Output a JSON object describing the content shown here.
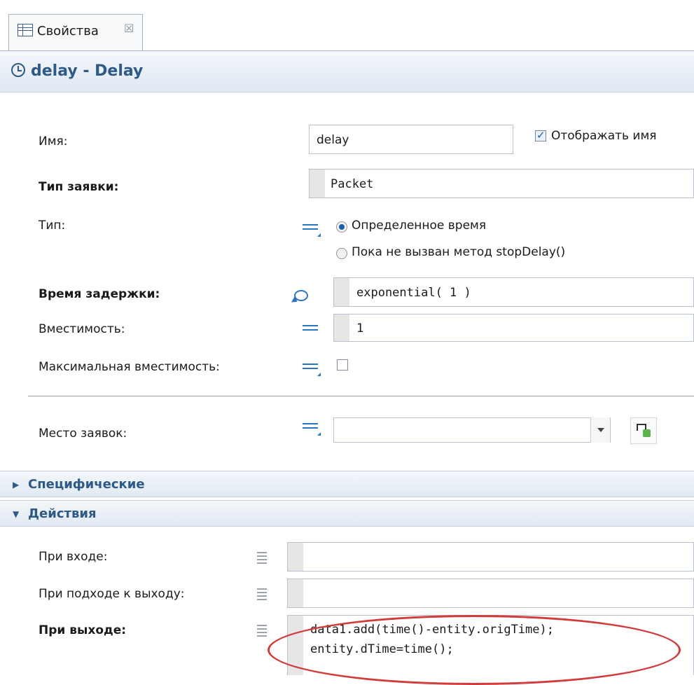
{
  "tab": {
    "label": "Свойства",
    "close": "☒"
  },
  "title": "delay - Delay",
  "props": {
    "name_label": "Имя:",
    "name_value": "delay",
    "show_name_label": "Отображать имя",
    "agent_type_label": "Тип заявки:",
    "agent_type_value": "Packet",
    "type_label": "Тип:",
    "type_option1": "Определенное время",
    "type_option2": "Пока не вызван метод stopDelay()",
    "delay_time_label": "Время задержки:",
    "delay_time_value": "exponential( 1 )",
    "capacity_label": "Вместимость:",
    "capacity_value": "1",
    "max_capacity_label": "Максимальная вместимость:",
    "agent_location_label": "Место заявок:"
  },
  "sections": {
    "specific": "Специфические",
    "actions": "Действия"
  },
  "actions": {
    "on_enter_label": "При входе:",
    "on_at_exit_label": "При подходе к выходу:",
    "on_exit_label": "При выходе:",
    "on_exit_line1": "data1.add(time()-entity.origTime);",
    "on_exit_line2": "entity.dTime=time();"
  },
  "state": {
    "show_name_checked": true,
    "selected_type_option": 1,
    "max_capacity_checked": false
  },
  "colors": {
    "title_blue": "#2d5a86",
    "icon_blue": "#2b74c2",
    "highlight_red": "#d33a3a"
  }
}
